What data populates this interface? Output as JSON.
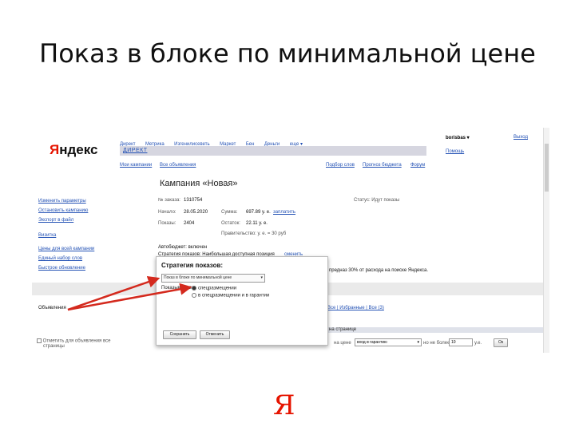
{
  "slide": {
    "title": "Показ в блоке по минимальной цене",
    "brand_mark": "Я"
  },
  "yandex": {
    "logo_first": "Я",
    "logo_rest": "ндекс",
    "top_links": [
      "Директ",
      "Метрика",
      "Изгенилисеветь",
      "Маркет",
      "Бен",
      "Деньги",
      "еще ▾"
    ],
    "user": "borisbas ▾",
    "logout": "Выход",
    "help": "Помощь",
    "direct_label": "ДИРЕКТ",
    "sub_links_left": [
      "Мои кампании",
      "Все объявления"
    ],
    "sub_links_right": [
      "Подбор слов",
      "Прогноз бюджета",
      "Форум"
    ],
    "colors": {
      "accent": "#e61400",
      "link": "#2452b5"
    }
  },
  "campaign": {
    "title": "Кампания «Новая»",
    "rows": [
      {
        "label": "№ заказа:",
        "value": "1310754"
      },
      {
        "label": "Начало:",
        "value": "28.05.2020"
      },
      {
        "label": "Показы:",
        "value": "2404"
      }
    ],
    "sum_label": "Сумма:",
    "sum_value": "697.89 у. е.",
    "sum_link": "заплатить",
    "rest_label": "Остаток:",
    "rest_value": "22.11 у. е.",
    "note": "Правительство: у. е. = 30 руб",
    "status": "Статус: Идут показы"
  },
  "sidebar": {
    "links": [
      "Изменить параметры",
      "Остановить кампанию",
      "Экспорт в файл",
      "Визитка",
      "Цены для всей кампании",
      "Единый набор слов",
      "Быстрое обновление"
    ]
  },
  "below": {
    "auto": "Автобюджет: включен",
    "strategy_line": "Стратегия показов: Наибольшая доступная позиция",
    "strategy_link": "сменить",
    "right_note": "предназ 30% от расхода на поиске Яндекса.",
    "ads_label": "Объявления",
    "filter_tabs": "Все | Избранные | Все (3)",
    "check_line1": "Отметить для объявления все",
    "check_line2": "страницы",
    "table_hdr": "на странице",
    "table_row_label": "на цене",
    "table_row_select": "вход в гарантию",
    "table_row_mid": "но не более",
    "table_row_value": "10",
    "table_row_unit": "у.е.",
    "ok_label": "Ок"
  },
  "dialog": {
    "title": "Стратегия показов:",
    "select_value": "Показ в блоке по минимальной цене",
    "show_in": "Показывать в:",
    "option_on": "спецразмещении",
    "option_off": "в спецразмещении и в гарантии",
    "save": "Сохранить",
    "cancel": "Отменить"
  }
}
